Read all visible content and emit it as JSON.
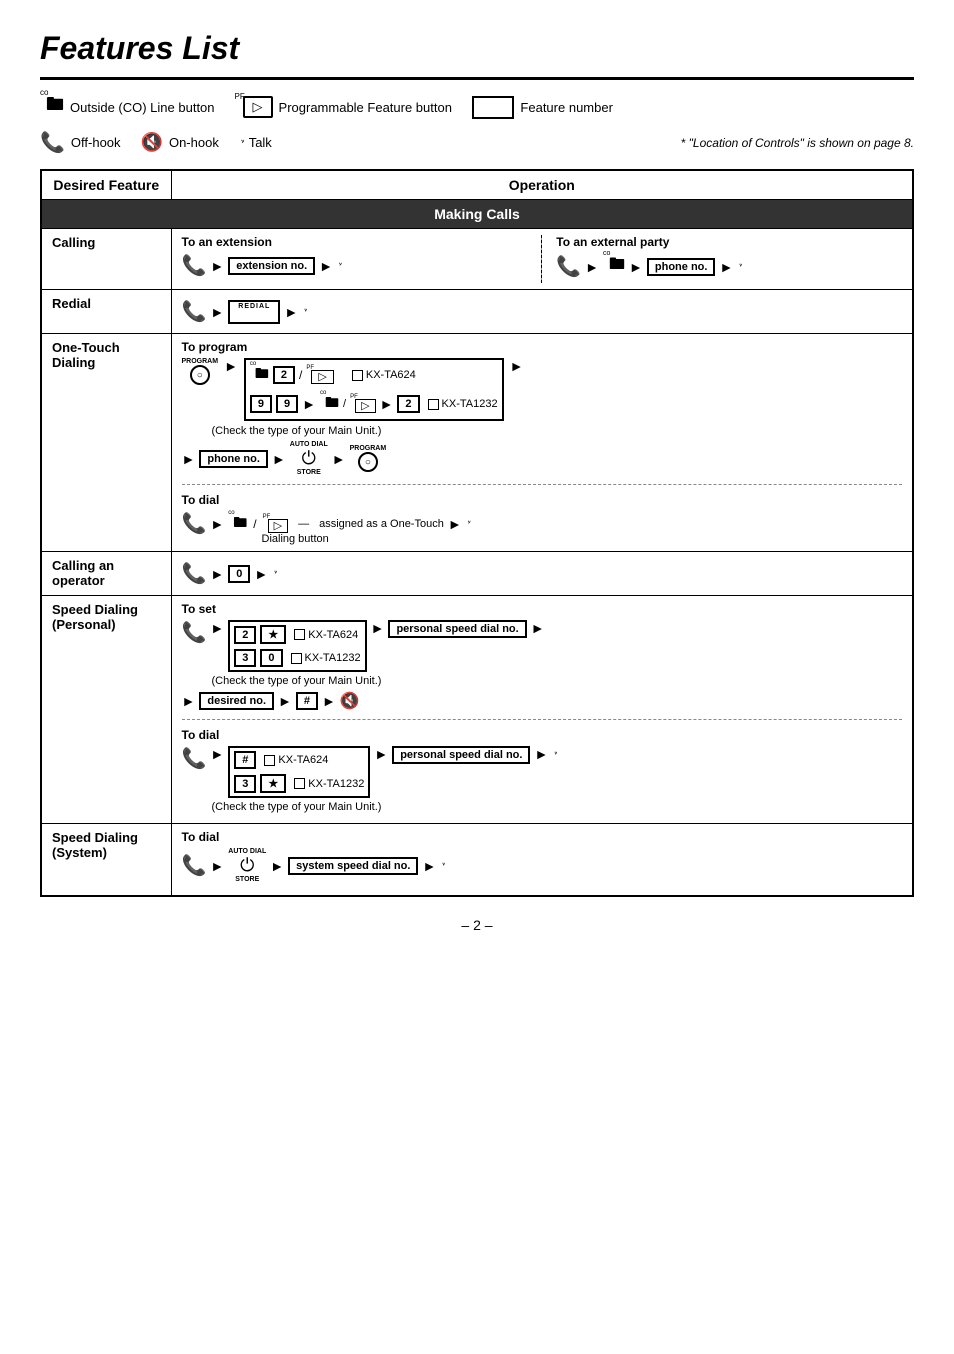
{
  "title": "Features List",
  "legend": {
    "co_label": "co",
    "co_text": "Outside (CO) Line button",
    "pf_label": "PF",
    "pf_text": "Programmable Feature button",
    "feature_number_text": "Feature number",
    "offhook_text": "Off-hook",
    "onhook_text": "On-hook",
    "talk_text": "Talk",
    "note": "* \"Location of Controls\" is shown on page 8."
  },
  "table": {
    "col1_header": "Desired Feature",
    "col2_header": "Operation",
    "section1": "Making Calls",
    "rows": [
      {
        "feature": "Calling",
        "op_label1": "To an extension",
        "op_label2": "To an external party"
      },
      {
        "feature": "Redial"
      },
      {
        "feature": "One-Touch\nDialing",
        "to_program": "To program",
        "to_dial": "To dial",
        "kx_ta624": "KX-TA624",
        "kx_ta1232": "KX-TA1232",
        "check_main_unit": "(Check the type of your Main Unit.)",
        "assigned_text": "assigned as a One-Touch",
        "dialing_button": "Dialing button"
      },
      {
        "feature": "Calling an\noperator"
      },
      {
        "feature": "Speed Dialing\n(Personal)",
        "to_set": "To set",
        "to_dial": "To dial",
        "kx_ta624": "KX-TA624",
        "kx_ta1232": "KX-TA1232",
        "check_main_unit": "(Check the type of your Main Unit.)"
      },
      {
        "feature": "Speed Dialing\n(System)",
        "to_dial": "To dial"
      }
    ]
  },
  "page_number": "– 2 –",
  "buttons": {
    "extension_no": "extension no.",
    "phone_no": "phone no.",
    "zero": "0",
    "two": "2",
    "three": "3",
    "star": "★",
    "hash": "#",
    "nine": "9",
    "desired_no": "desired no.",
    "personal_speed_dial_no": "personal speed dial no.",
    "system_speed_dial_no": "system speed dial no.",
    "program_label": "PROGRAM",
    "auto_dial_label": "AUTO DIAL",
    "store_label": "STORE",
    "phone_no_label": "phone no."
  }
}
